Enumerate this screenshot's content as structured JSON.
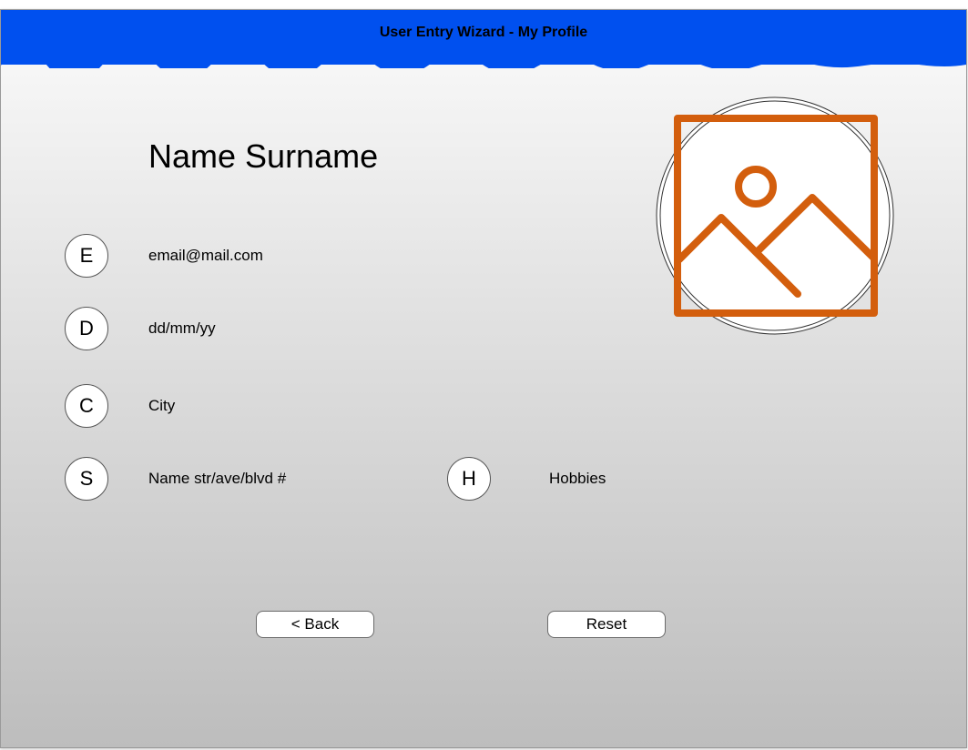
{
  "window": {
    "title": "User Entry Wizard - My Profile"
  },
  "profile": {
    "name": "Name Surname",
    "avatar_icon": "image-placeholder-icon"
  },
  "fields": {
    "email": {
      "badge": "E",
      "value": "email@mail.com"
    },
    "date": {
      "badge": "D",
      "value": "dd/mm/yy"
    },
    "city": {
      "badge": "C",
      "value": "City"
    },
    "street": {
      "badge": "S",
      "value": "Name str/ave/blvd #"
    },
    "hobbies": {
      "badge": "H",
      "value": "Hobbies"
    }
  },
  "buttons": {
    "back_label": "< Back",
    "reset_label": "Reset"
  },
  "colors": {
    "titlebar": "#0050ef",
    "image_icon": "#d35e0d"
  }
}
